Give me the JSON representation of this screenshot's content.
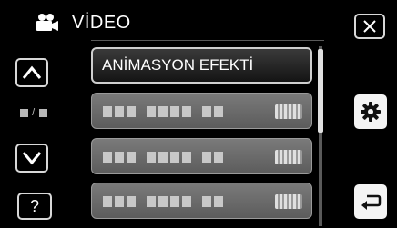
{
  "header": {
    "title": "VİDEO",
    "icon": "video-camera-icon"
  },
  "buttons": {
    "close_icon": "close-icon",
    "up_icon": "chevron-up-icon",
    "down_icon": "chevron-down-icon",
    "help_label": "?",
    "settings_icon": "gear-icon",
    "back_icon": "return-icon"
  },
  "pager": {
    "separator": "/"
  },
  "menu": {
    "items": [
      {
        "label": "ANİMASYON EFEKTİ",
        "active": true
      },
      {
        "label": "",
        "active": false
      },
      {
        "label": "",
        "active": false
      },
      {
        "label": "",
        "active": false
      }
    ]
  },
  "colors": {
    "background": "#000000",
    "item_inactive": "#6a6a6a",
    "item_active": "#222222",
    "border": "#d8d8d8"
  }
}
